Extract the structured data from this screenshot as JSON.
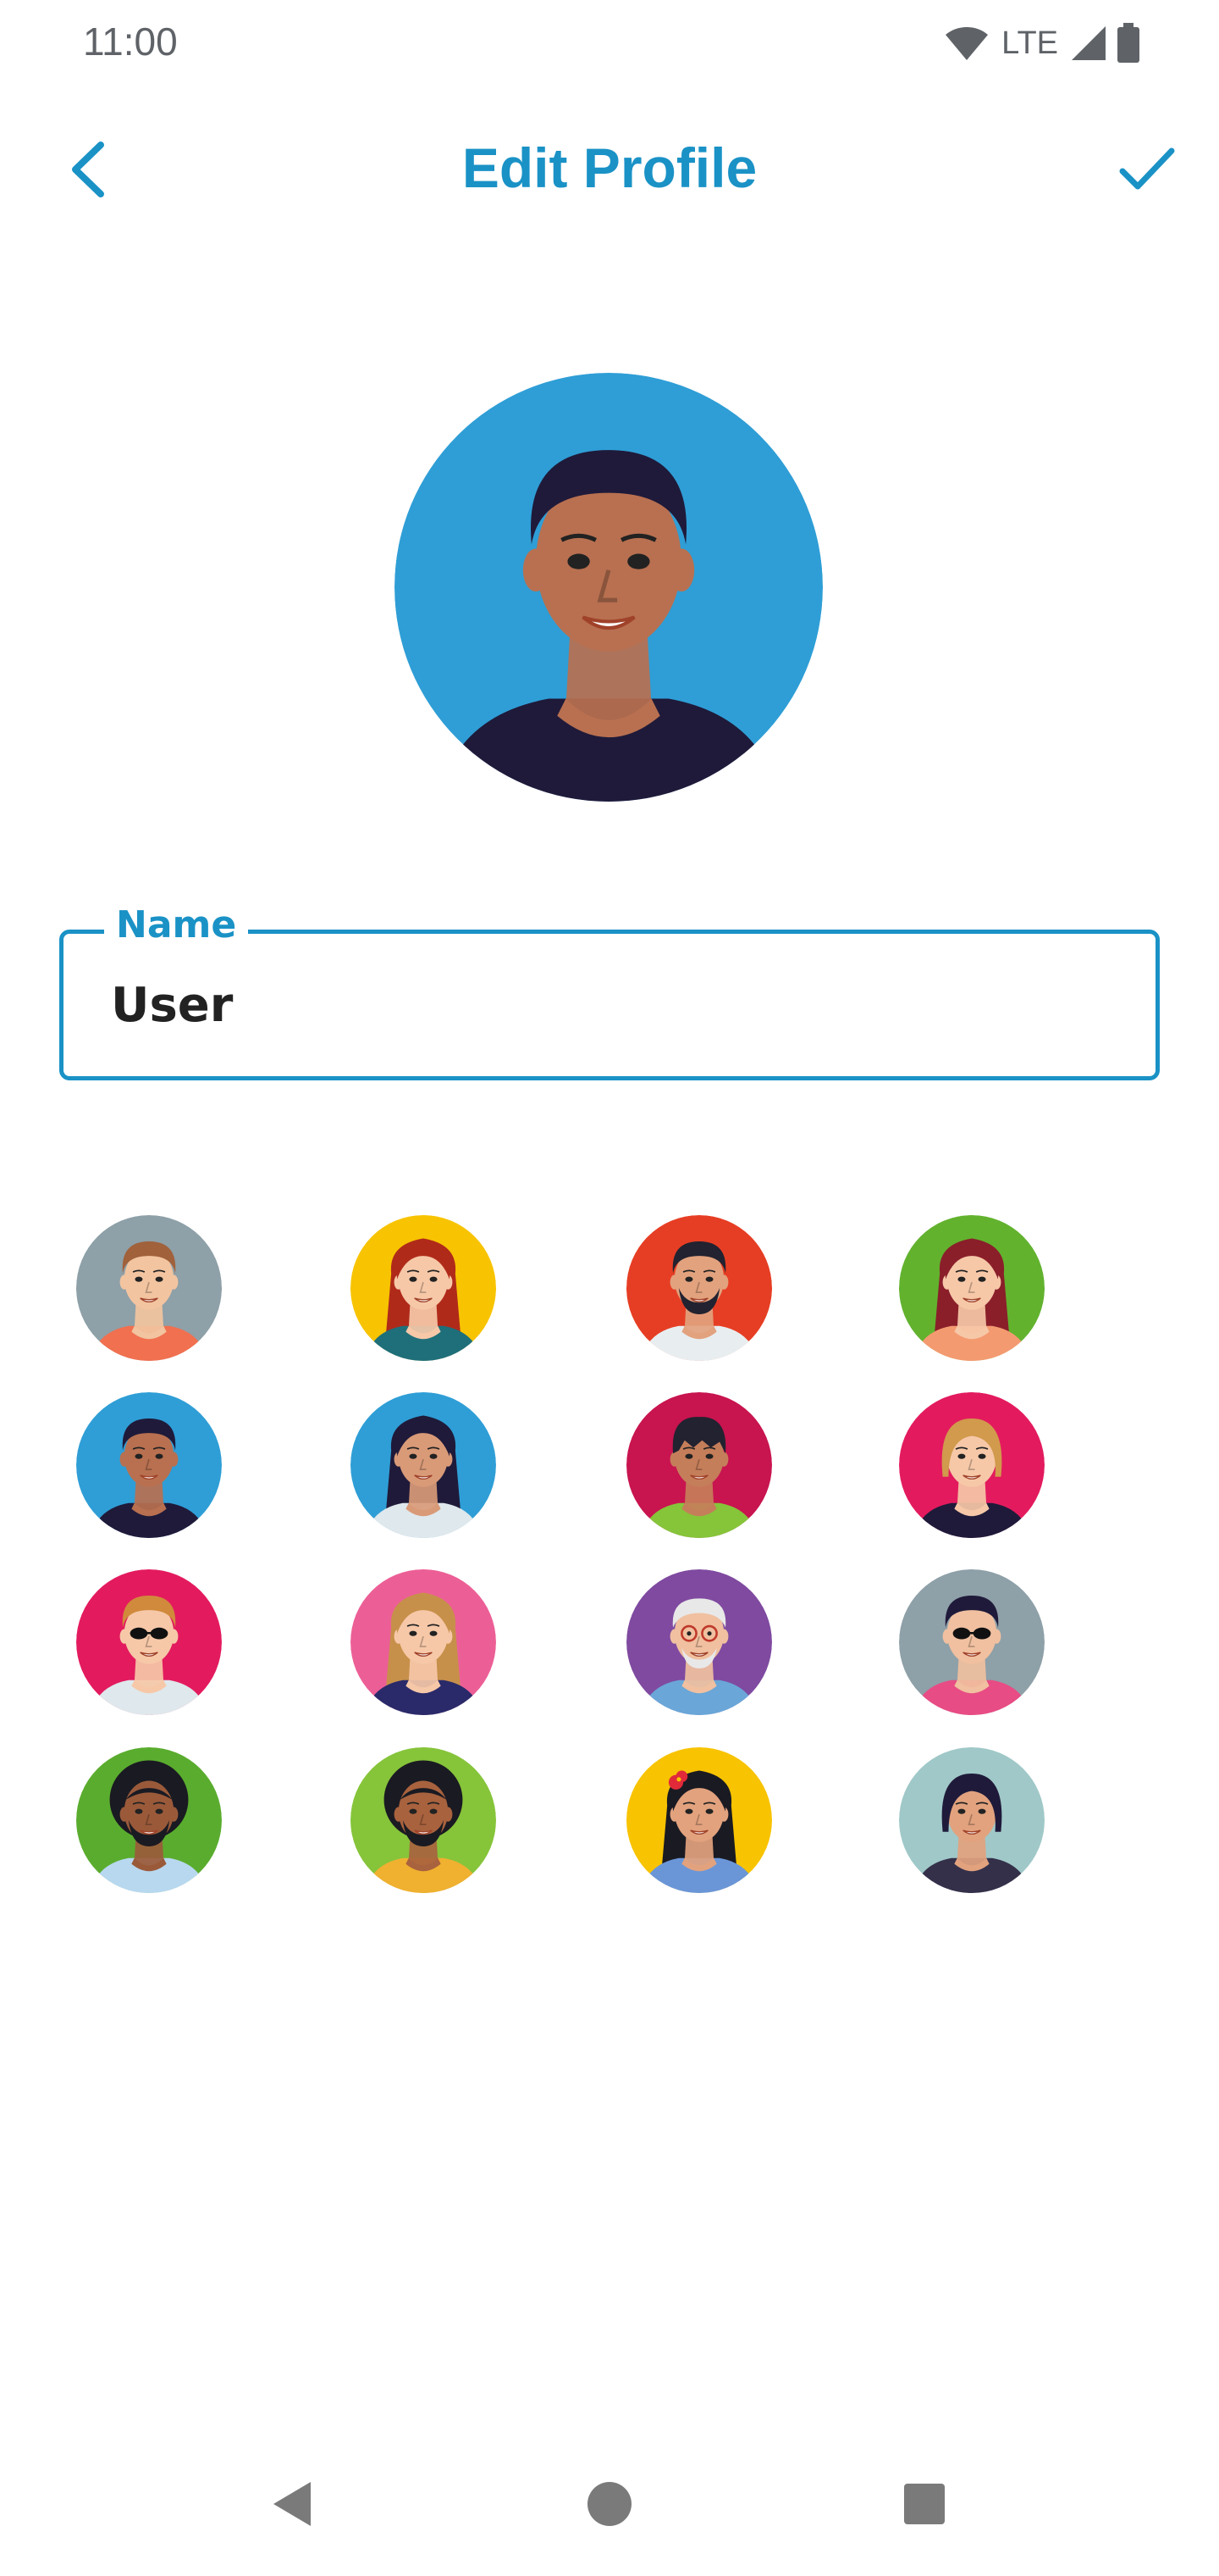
{
  "status_bar": {
    "time": "11:00",
    "network": "LTE",
    "icons": [
      "wifi-icon",
      "cell-signal-icon",
      "battery-icon"
    ]
  },
  "app_bar": {
    "title": "Edit Profile",
    "back_icon": "chevron-left-icon",
    "done_icon": "checkmark-icon"
  },
  "profile": {
    "name_label": "Name",
    "name_value": "User",
    "selected_avatar": 4
  },
  "avatars": [
    {
      "bg": "#8ea0a8",
      "skin": "#f2c4a0",
      "hair": "#a0613b",
      "shirt": "#f07050",
      "style": "short"
    },
    {
      "bg": "#f8c300",
      "skin": "#f6c8a8",
      "hair": "#b02a1a",
      "shirt": "#1e6f7a",
      "style": "long"
    },
    {
      "bg": "#e63e24",
      "skin": "#e2a27e",
      "hair": "#222230",
      "shirt": "#e8eef0",
      "style": "beard"
    },
    {
      "bg": "#62b22e",
      "skin": "#f6c8a8",
      "hair": "#8a1f2a",
      "shirt": "#f49a70",
      "style": "long"
    },
    {
      "bg": "#2f9ed6",
      "skin": "#b87050",
      "hair": "#1f1a3a",
      "shirt": "#1f1a3a",
      "style": "short"
    },
    {
      "bg": "#2f9ed6",
      "skin": "#d99a78",
      "hair": "#1f1a3a",
      "shirt": "#dfe8ec",
      "style": "long"
    },
    {
      "bg": "#c8144f",
      "skin": "#c57e5a",
      "hair": "#222230",
      "shirt": "#86c43a",
      "style": "fringe"
    },
    {
      "bg": "#e31b5e",
      "skin": "#f6c8a8",
      "hair": "#d19a4c",
      "shirt": "#1f1a3a",
      "style": "bob"
    },
    {
      "bg": "#e31b5e",
      "skin": "#f6c8a8",
      "hair": "#d18a3c",
      "shirt": "#dfe8ec",
      "style": "glasses"
    },
    {
      "bg": "#ec5f96",
      "skin": "#f6c8a8",
      "hair": "#c7904a",
      "shirt": "#2a2a6a",
      "style": "long"
    },
    {
      "bg": "#7f4aa0",
      "skin": "#f0c0a0",
      "hair": "#e8e8e8",
      "shirt": "#6aa6d8",
      "style": "elder"
    },
    {
      "bg": "#8ea0a8",
      "skin": "#f0c0a0",
      "hair": "#1f1a3a",
      "shirt": "#e84c84",
      "style": "glasses"
    },
    {
      "bg": "#5aac2e",
      "skin": "#9a5a3a",
      "hair": "#1a1a22",
      "shirt": "#b8d8f0",
      "style": "afro"
    },
    {
      "bg": "#86c43a",
      "skin": "#a8623e",
      "hair": "#1a1a22",
      "shirt": "#f0b030",
      "style": "afro"
    },
    {
      "bg": "#f8c300",
      "skin": "#e2a27e",
      "hair": "#1a1a22",
      "shirt": "#6a96d8",
      "style": "flower"
    },
    {
      "bg": "#a0c8c8",
      "skin": "#e2a27e",
      "hair": "#1f1a3a",
      "shirt": "#34304a",
      "style": "bob"
    }
  ],
  "nav_bar": {
    "buttons": [
      "back-triangle-icon",
      "home-circle-icon",
      "recents-square-icon"
    ]
  }
}
